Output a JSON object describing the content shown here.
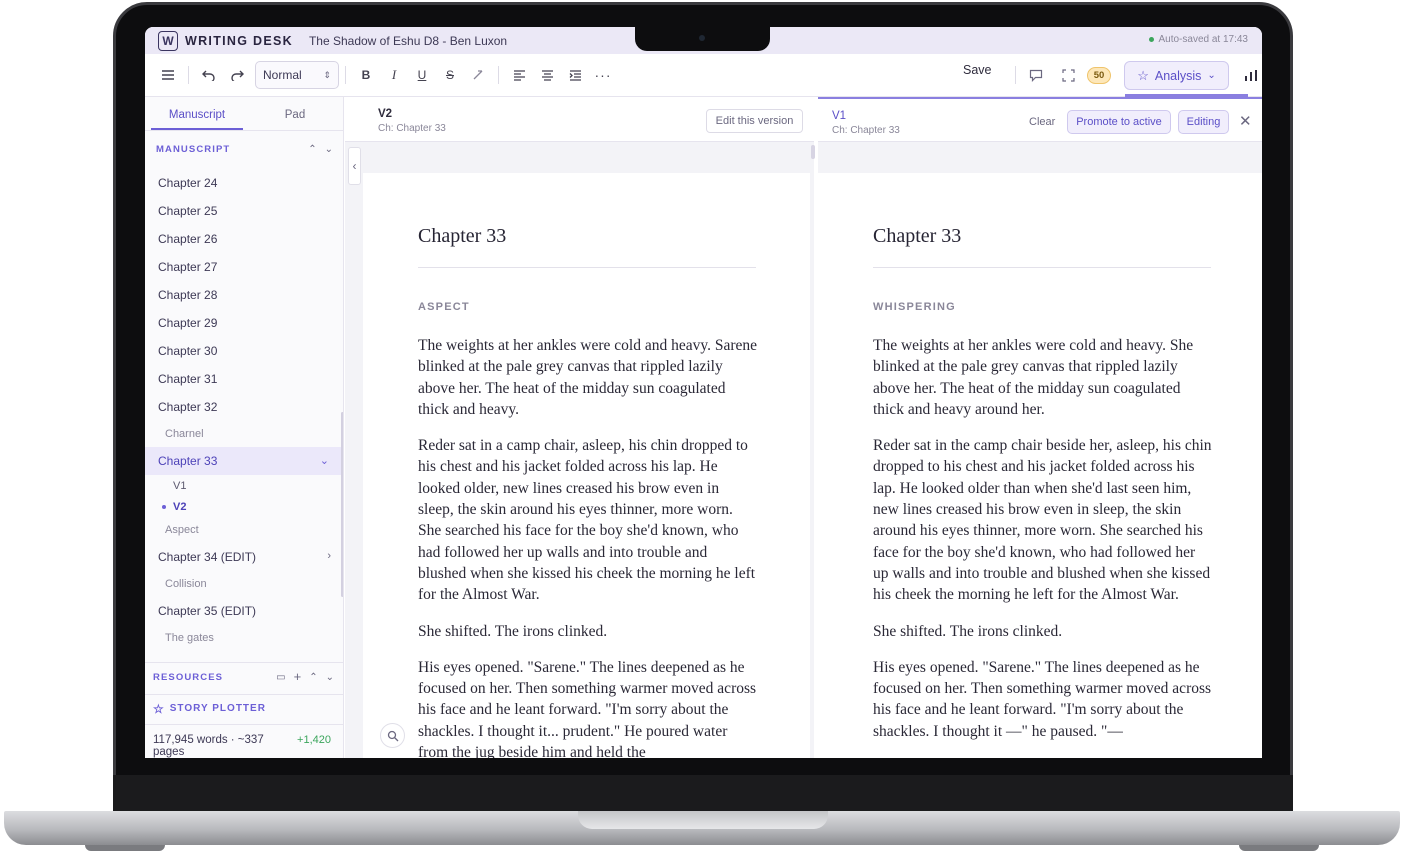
{
  "titlebar": {
    "app_name": "WRITING DESK",
    "doc_title": "The Shadow of Eshu D8 - Ben Luxon",
    "autosave": "Auto-saved at 17:43"
  },
  "toolbar": {
    "style_select_value": "Normal",
    "save_label": "Save",
    "count_badge": "50",
    "analysis_label": "Analysis"
  },
  "sidebar": {
    "tabs": [
      "Manuscript",
      "Pad"
    ],
    "manuscript_label": "MANUSCRIPT",
    "chapters": {
      "ch24": "Chapter 24",
      "ch25": "Chapter 25",
      "ch26": "Chapter 26",
      "ch27": "Chapter 27",
      "ch28": "Chapter 28",
      "ch29": "Chapter 29",
      "ch30": "Chapter 30",
      "ch31": "Chapter 31",
      "ch32": "Chapter 32",
      "ch32_sub": "Charnel",
      "ch33": "Chapter 33",
      "ch33_v1": "V1",
      "ch33_v2": "V2",
      "ch33_sub": "Aspect",
      "ch34": "Chapter 34 (EDIT)",
      "ch34_sub": "Collision",
      "ch35": "Chapter 35 (EDIT)",
      "ch35_sub": "The gates"
    },
    "resources_label": "RESOURCES",
    "story_plotter_label": "STORY PLOTTER",
    "word_count": "117,945 words · ~337 pages",
    "word_delta": "+1,420"
  },
  "left_pane": {
    "version": "V2",
    "chapter_ref": "Ch: Chapter 33",
    "edit_button": "Edit this version",
    "heading": "Chapter 33",
    "scene": "ASPECT",
    "paragraphs": [
      "The weights at her ankles were cold and heavy. Sarene blinked at the pale grey canvas that rippled lazily above her. The heat of the midday sun coagulated thick and heavy.",
      "Reder sat in a camp chair, asleep, his chin dropped to his chest and his jacket folded across his lap. He looked older, new lines creased his brow even in sleep, the skin around his eyes thinner, more worn. She searched his face for the boy she'd known, who had followed her up walls and into trouble and blushed when she kissed his cheek the morning he left for the Almost War.",
      "She shifted. The irons clinked.",
      "His eyes opened. \"Sarene.\" The lines deepened as he focused on her. Then something warmer moved across his face and he leant forward. \"I'm sorry about the shackles. I thought it... prudent.\" He poured water from the jug beside him and held the"
    ]
  },
  "right_pane": {
    "version": "V1",
    "chapter_ref": "Ch: Chapter 33",
    "clear_button": "Clear",
    "promote_button": "Promote to active",
    "editing_button": "Editing",
    "heading": "Chapter 33",
    "scene": "WHISPERING",
    "paragraphs": [
      "The weights at her ankles were cold and heavy. She blinked at the pale grey canvas that rippled lazily above her. The heat of the midday sun coagulated thick and heavy around her.",
      "Reder sat in the camp chair beside her, asleep, his chin dropped to his chest and his jacket folded across his lap. He looked older than when she'd last seen him, new lines creased his brow even in sleep, the skin around his eyes thinner, more worn. She searched his face for the boy she'd known, who had followed her up walls and into trouble and blushed when she kissed his cheek the morning he left for the Almost War.",
      "She shifted. The irons clinked.",
      "His eyes opened. \"Sarene.\" The lines deepened as he focused on her. Then something warmer moved across his face and he leant forward. \"I'm sorry about the shackles. I thought it —\" he paused. \"—"
    ]
  },
  "icons": {
    "menu": "menu-icon",
    "undo": "undo-icon",
    "redo": "redo-icon",
    "bold": "bold-icon",
    "italic": "italic-icon",
    "underline": "underline-icon",
    "strike": "strikethrough-icon",
    "clear_format": "clear-format-icon",
    "align_left": "align-left-icon",
    "align_center": "align-center-icon",
    "indent": "indent-icon",
    "more": "more-icon",
    "comment": "comment-icon",
    "fullscreen": "fullscreen-icon",
    "star": "star-icon",
    "stats": "bar-chart-icon",
    "search": "search-icon"
  },
  "colors": {
    "accent": "#6c5fd6",
    "titlebar_bg": "#ebe8f6",
    "positive": "#3ba55c"
  }
}
